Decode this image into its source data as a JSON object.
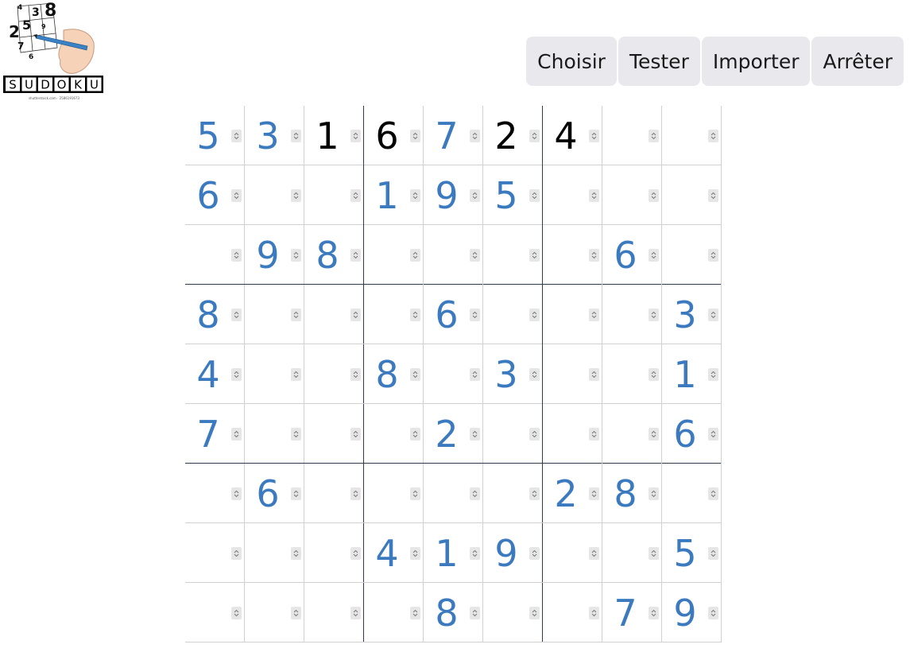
{
  "logo": {
    "title": "SUDOKU",
    "letters": [
      "S",
      "U",
      "D",
      "O",
      "K",
      "U"
    ],
    "sketch_digits": [
      "4",
      "2",
      "5",
      "3",
      "8",
      "9",
      "7",
      "6"
    ],
    "credit": "shutterstock.com · 2586191673"
  },
  "toolbar": {
    "buttons": [
      "Choisir",
      "Tester",
      "Importer",
      "Arrêter"
    ]
  },
  "colors": {
    "given_digit": "#3c7ac0",
    "entered_digit": "#000000",
    "block_border": "#2f3b4d",
    "cell_border": "#d0d0d0",
    "button_bg": "#e9e9ed"
  },
  "sudoku": {
    "rows": [
      [
        "5",
        "3",
        "1",
        "6",
        "7",
        "2",
        "4",
        "",
        ""
      ],
      [
        "6",
        "",
        "",
        "1",
        "9",
        "5",
        "",
        "",
        ""
      ],
      [
        "",
        "9",
        "8",
        "",
        "",
        "",
        "",
        "6",
        ""
      ],
      [
        "8",
        "",
        "",
        "",
        "6",
        "",
        "",
        "",
        "3"
      ],
      [
        "4",
        "",
        "",
        "8",
        "",
        "3",
        "",
        "",
        "1"
      ],
      [
        "7",
        "",
        "",
        "",
        "2",
        "",
        "",
        "",
        "6"
      ],
      [
        "",
        "6",
        "",
        "",
        "",
        "",
        "2",
        "8",
        ""
      ],
      [
        "",
        "",
        "",
        "4",
        "1",
        "9",
        "",
        "",
        "5"
      ],
      [
        "",
        "",
        "",
        "",
        "8",
        "",
        "",
        "7",
        "9"
      ]
    ],
    "kinds": [
      [
        "given",
        "given",
        "entered",
        "entered",
        "given",
        "entered",
        "entered",
        "",
        ""
      ],
      [
        "given",
        "",
        "",
        "given",
        "given",
        "given",
        "",
        "",
        ""
      ],
      [
        "",
        "given",
        "given",
        "",
        "",
        "",
        "",
        "given",
        ""
      ],
      [
        "given",
        "",
        "",
        "",
        "given",
        "",
        "",
        "",
        "given"
      ],
      [
        "given",
        "",
        "",
        "given",
        "",
        "given",
        "",
        "",
        "given"
      ],
      [
        "given",
        "",
        "",
        "",
        "given",
        "",
        "",
        "",
        "given"
      ],
      [
        "",
        "given",
        "",
        "",
        "",
        "",
        "given",
        "given",
        ""
      ],
      [
        "",
        "",
        "",
        "given",
        "given",
        "given",
        "",
        "",
        "given"
      ],
      [
        "",
        "",
        "",
        "",
        "given",
        "",
        "",
        "given",
        "given"
      ]
    ]
  }
}
